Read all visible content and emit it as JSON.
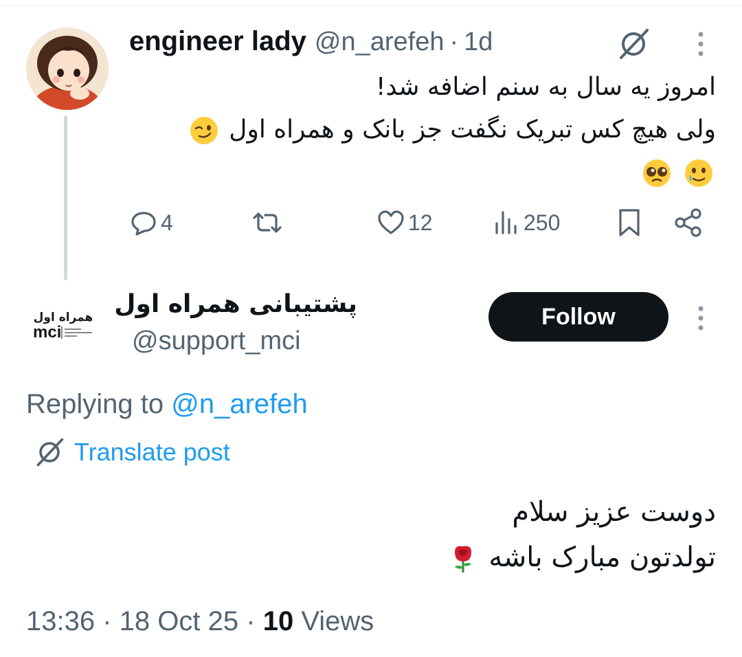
{
  "tweet": {
    "author_name": "engineer lady",
    "handle": "@n_arefeh",
    "separator": "·",
    "time": "1d",
    "line1": "امروز یه سال به سنم اضافه شد!",
    "line2": "ولی هیچ کس تبریک نگفت جز بانک و همراه اول",
    "icons": {
      "translate": "grok-no-icon",
      "more": "vertical-dots-icon",
      "emoji_wink": "winking-face-emoji",
      "emoji_pleading": "pleading-face-emoji",
      "emoji_tear": "smiling-face-with-tear-emoji"
    },
    "actions": {
      "replies": "4",
      "likes": "12",
      "views": "250"
    }
  },
  "reply": {
    "display_name": "پشتیبانی همراه اول",
    "handle": "@support_mci",
    "follow_label": "Follow",
    "logo_text": "همراه اول",
    "logo_sub": "mci",
    "replying_prefix": "Replying to",
    "replying_to": "@n_arefeh",
    "translate_label": "Translate post",
    "line1": "دوست عزیز سلام",
    "line2": "تولدتون مبارک باشه",
    "emoji": "rose-emoji",
    "meta": {
      "time": "13:36",
      "sep": "·",
      "date": "18 Oct 25",
      "views_count": "10",
      "views_label": "Views"
    }
  },
  "colors": {
    "text": "#0f1419",
    "secondary": "#536471",
    "link": "#1d9bf0",
    "thread_line": "#cfd9de",
    "button_bg": "#0f1419"
  }
}
